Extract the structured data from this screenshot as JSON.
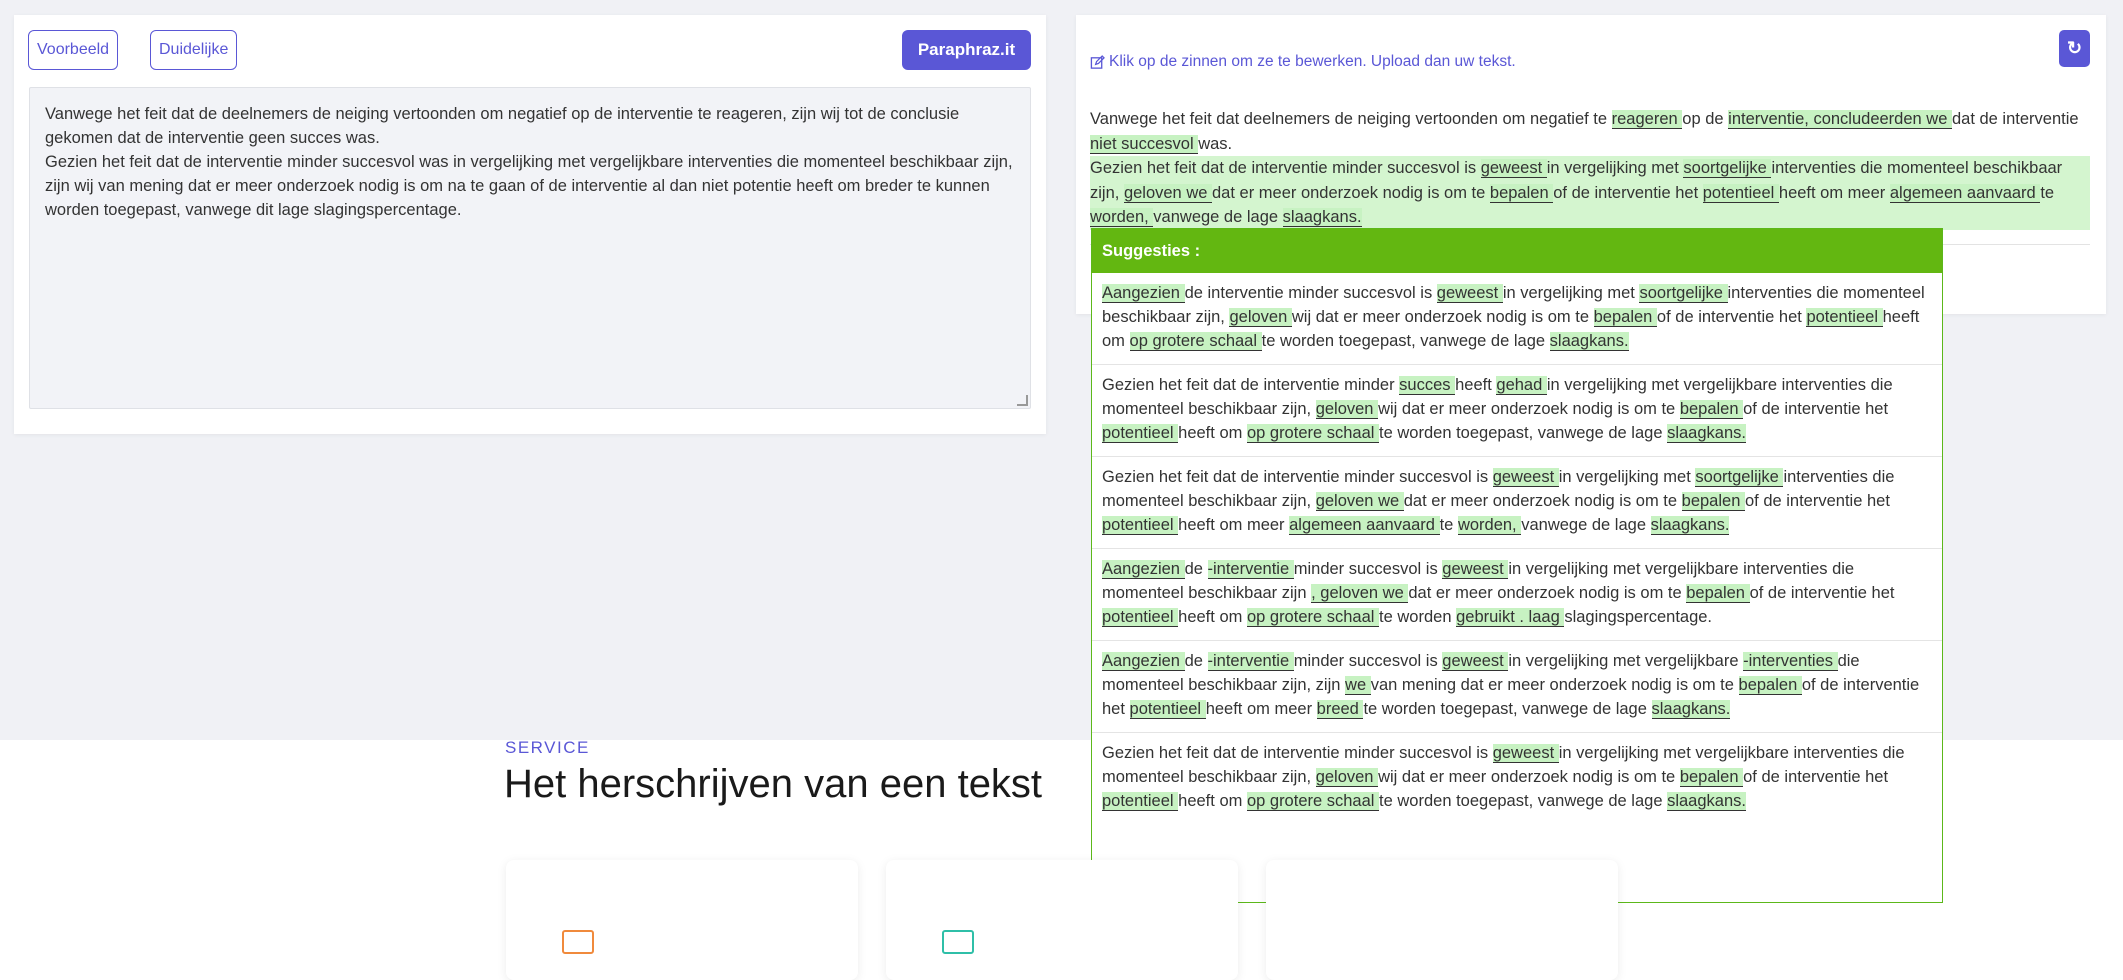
{
  "toolbar": {
    "example_label": "Voorbeeld",
    "clear_label": "Duidelijke",
    "paraphrase_label": "Paraphraz.it"
  },
  "input": {
    "paragraphs": [
      "Vanwege het feit dat de deelnemers de neiging vertoonden om negatief op de interventie te reageren, zijn wij tot de conclusie gekomen dat de interventie geen succes was.",
      "Gezien het feit dat de interventie minder succesvol was in vergelijking met vergelijkbare interventies die momenteel beschikbaar zijn, zijn wij van mening dat er meer onderzoek nodig is om na te gaan of de interventie al dan niet potentie heeft om breder te kunnen worden toegepast, vanwege dit lage slagingspercentage."
    ]
  },
  "output": {
    "hint": "Klik op de zinnen om ze te bewerken. Upload dan uw tekst.",
    "refresh_icon": "↻",
    "sentence1": [
      {
        "t": "Vanwege het feit dat deelnemers de neiging vertoonden om negatief te ",
        "h": false
      },
      {
        "t": "reageren ",
        "h": true
      },
      {
        "t": "op de ",
        "h": false
      },
      {
        "t": "interventie, concludeerden we ",
        "h": true
      },
      {
        "t": "dat de interventie ",
        "h": false
      },
      {
        "t": "niet succesvol ",
        "h": true
      },
      {
        "t": "was.",
        "h": false
      }
    ],
    "sentence2": [
      {
        "t": "Gezien het feit dat de interventie minder succesvol is ",
        "h": false
      },
      {
        "t": "geweest ",
        "h": true
      },
      {
        "t": "in vergelijking met ",
        "h": false
      },
      {
        "t": "soortgelijke ",
        "h": true
      },
      {
        "t": "interventies die momenteel beschikbaar zijn, ",
        "h": false
      },
      {
        "t": "geloven we ",
        "h": true
      },
      {
        "t": "dat er meer onderzoek nodig is om te ",
        "h": false
      },
      {
        "t": "bepalen ",
        "h": true
      },
      {
        "t": "of de interventie het ",
        "h": false
      },
      {
        "t": "potentieel ",
        "h": true
      },
      {
        "t": "heeft om meer ",
        "h": false
      },
      {
        "t": "algemeen aanvaard ",
        "h": true
      },
      {
        "t": "te ",
        "h": false
      },
      {
        "t": "worden, ",
        "h": true
      },
      {
        "t": "vanwege de lage ",
        "h": false
      },
      {
        "t": "slaagkans.",
        "h": true
      }
    ]
  },
  "suggestions": {
    "title": "Suggesties :",
    "items": [
      [
        {
          "t": "Aangezien ",
          "h": true
        },
        {
          "t": "de interventie minder succesvol is ",
          "h": false
        },
        {
          "t": "geweest ",
          "h": true
        },
        {
          "t": "in vergelijking met ",
          "h": false
        },
        {
          "t": "soortgelijke ",
          "h": true
        },
        {
          "t": "interventies die momenteel beschikbaar zijn, ",
          "h": false
        },
        {
          "t": "geloven ",
          "h": true
        },
        {
          "t": "wij dat er meer onderzoek nodig is om te ",
          "h": false
        },
        {
          "t": "bepalen ",
          "h": true
        },
        {
          "t": "of de interventie het ",
          "h": false
        },
        {
          "t": "potentieel ",
          "h": true
        },
        {
          "t": "heeft om ",
          "h": false
        },
        {
          "t": "op grotere schaal ",
          "h": true
        },
        {
          "t": "te worden toegepast, vanwege de lage ",
          "h": false
        },
        {
          "t": "slaagkans.",
          "h": true
        }
      ],
      [
        {
          "t": "Gezien het feit dat de interventie minder ",
          "h": false
        },
        {
          "t": "succes ",
          "h": true
        },
        {
          "t": "heeft ",
          "h": false
        },
        {
          "t": "gehad ",
          "h": true
        },
        {
          "t": "in vergelijking met vergelijkbare interventies die momenteel beschikbaar zijn, ",
          "h": false
        },
        {
          "t": "geloven ",
          "h": true
        },
        {
          "t": "wij dat er meer onderzoek nodig is om te ",
          "h": false
        },
        {
          "t": "bepalen ",
          "h": true
        },
        {
          "t": "of de interventie het ",
          "h": false
        },
        {
          "t": "potentieel ",
          "h": true
        },
        {
          "t": "heeft om ",
          "h": false
        },
        {
          "t": "op grotere schaal ",
          "h": true
        },
        {
          "t": "te worden toegepast, vanwege de lage ",
          "h": false
        },
        {
          "t": "slaagkans.",
          "h": true
        }
      ],
      [
        {
          "t": "Gezien het feit dat de interventie minder succesvol is ",
          "h": false
        },
        {
          "t": "geweest ",
          "h": true
        },
        {
          "t": "in vergelijking met ",
          "h": false
        },
        {
          "t": "soortgelijke ",
          "h": true
        },
        {
          "t": "interventies die momenteel beschikbaar zijn, ",
          "h": false
        },
        {
          "t": "geloven we ",
          "h": true
        },
        {
          "t": "dat er meer onderzoek nodig is om te ",
          "h": false
        },
        {
          "t": "bepalen ",
          "h": true
        },
        {
          "t": "of de interventie het ",
          "h": false
        },
        {
          "t": "potentieel ",
          "h": true
        },
        {
          "t": "heeft om meer ",
          "h": false
        },
        {
          "t": "algemeen aanvaard ",
          "h": true
        },
        {
          "t": "te ",
          "h": false
        },
        {
          "t": "worden, ",
          "h": true
        },
        {
          "t": "vanwege de lage ",
          "h": false
        },
        {
          "t": "slaagkans.",
          "h": true
        }
      ],
      [
        {
          "t": "Aangezien ",
          "h": true
        },
        {
          "t": "de ",
          "h": false
        },
        {
          "t": "-interventie ",
          "h": true
        },
        {
          "t": "minder succesvol is ",
          "h": false
        },
        {
          "t": "geweest ",
          "h": true
        },
        {
          "t": "in vergelijking met vergelijkbare interventies die momenteel beschikbaar zijn ",
          "h": false
        },
        {
          "t": ", geloven we ",
          "h": true
        },
        {
          "t": "dat er meer onderzoek nodig is om te ",
          "h": false
        },
        {
          "t": "bepalen ",
          "h": true
        },
        {
          "t": "of de interventie het ",
          "h": false
        },
        {
          "t": "potentieel ",
          "h": true
        },
        {
          "t": "heeft om ",
          "h": false
        },
        {
          "t": "op grotere schaal ",
          "h": true
        },
        {
          "t": "te worden ",
          "h": false
        },
        {
          "t": "gebruikt . laag ",
          "h": true
        },
        {
          "t": "slagingspercentage.",
          "h": false
        }
      ],
      [
        {
          "t": "Aangezien ",
          "h": true
        },
        {
          "t": "de ",
          "h": false
        },
        {
          "t": "-interventie ",
          "h": true
        },
        {
          "t": "minder succesvol is ",
          "h": false
        },
        {
          "t": "geweest ",
          "h": true
        },
        {
          "t": "in vergelijking met vergelijkbare ",
          "h": false
        },
        {
          "t": "-interventies ",
          "h": true
        },
        {
          "t": "die momenteel beschikbaar zijn, zijn ",
          "h": false
        },
        {
          "t": "we ",
          "h": true
        },
        {
          "t": "van mening dat er meer onderzoek nodig is om te ",
          "h": false
        },
        {
          "t": "bepalen ",
          "h": true
        },
        {
          "t": "of de interventie het ",
          "h": false
        },
        {
          "t": "potentieel ",
          "h": true
        },
        {
          "t": "heeft om meer ",
          "h": false
        },
        {
          "t": "breed ",
          "h": true
        },
        {
          "t": "te worden toegepast, vanwege de lage ",
          "h": false
        },
        {
          "t": "slaagkans.",
          "h": true
        }
      ],
      [
        {
          "t": "Gezien het feit dat de interventie minder succesvol is ",
          "h": false
        },
        {
          "t": "geweest ",
          "h": true
        },
        {
          "t": "in vergelijking met vergelijkbare interventies die momenteel beschikbaar zijn, ",
          "h": false
        },
        {
          "t": "geloven ",
          "h": true
        },
        {
          "t": "wij dat er meer onderzoek nodig is om te ",
          "h": false
        },
        {
          "t": "bepalen ",
          "h": true
        },
        {
          "t": "of de interventie het ",
          "h": false
        },
        {
          "t": "potentieel ",
          "h": true
        },
        {
          "t": "heeft om ",
          "h": false
        },
        {
          "t": "op grotere schaal ",
          "h": true
        },
        {
          "t": "te worden toegepast, vanwege de lage ",
          "h": false
        },
        {
          "t": "slaagkans.",
          "h": true
        }
      ]
    ]
  },
  "service": {
    "label": "SERVICE",
    "title": "Het herschrijven van een tekst"
  },
  "colors": {
    "accent": "#5a57d6",
    "suggestion_header": "#63b711",
    "highlight": "#c7f2c2"
  }
}
